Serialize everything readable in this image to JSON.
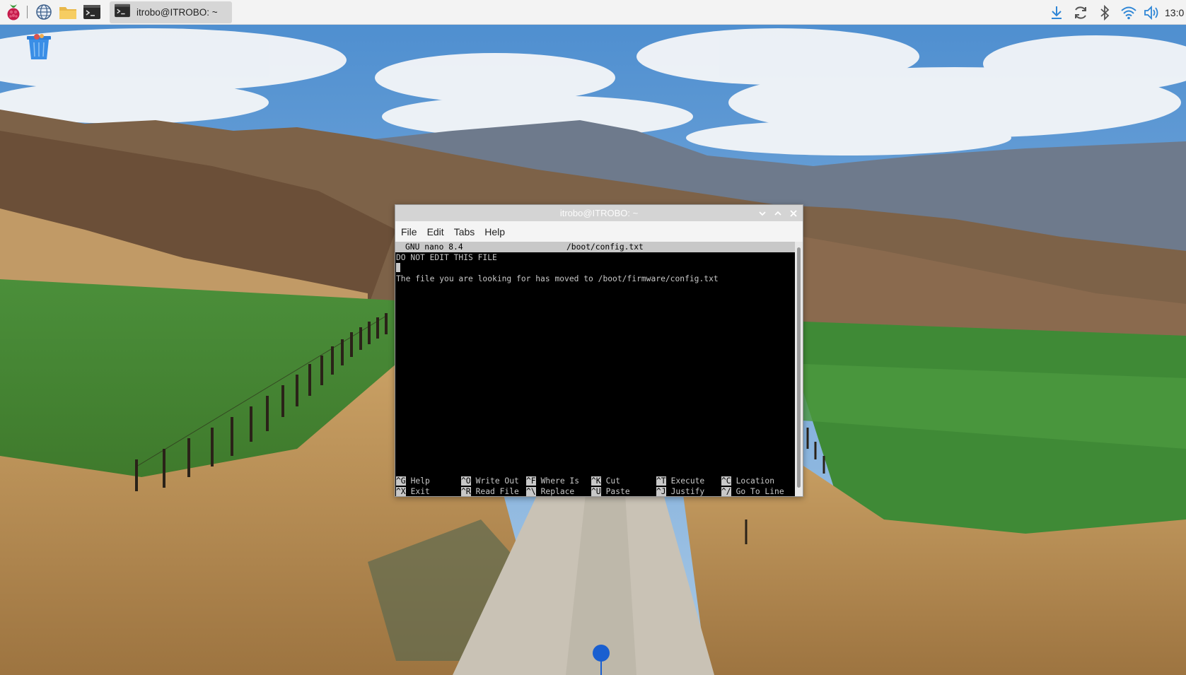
{
  "taskbar": {
    "launchers": [
      {
        "name": "raspberry-menu-icon"
      },
      {
        "name": "web-browser-icon"
      },
      {
        "name": "file-manager-icon"
      },
      {
        "name": "terminal-icon"
      }
    ],
    "task": {
      "label": "itrobo@ITROBO: ~"
    },
    "tray": [
      "download-icon",
      "sync-icon",
      "bluetooth-icon",
      "wifi-icon",
      "volume-icon"
    ],
    "clock": "13:0"
  },
  "desktop": {
    "icons": [
      {
        "name": "trash-icon"
      }
    ]
  },
  "window": {
    "title": "itrobo@ITROBO: ~",
    "menu": [
      "File",
      "Edit",
      "Tabs",
      "Help"
    ],
    "nano": {
      "version": "GNU nano 8.4",
      "filename": "/boot/config.txt",
      "lines": [
        "DO NOT EDIT THIS FILE",
        "",
        "The file you are looking for has moved to /boot/firmware/config.txt"
      ],
      "shortcuts": [
        [
          {
            "key": "^G",
            "label": "Help"
          },
          {
            "key": "^O",
            "label": "Write Out"
          },
          {
            "key": "^F",
            "label": "Where Is"
          },
          {
            "key": "^K",
            "label": "Cut"
          },
          {
            "key": "^T",
            "label": "Execute"
          },
          {
            "key": "^C",
            "label": "Location"
          }
        ],
        [
          {
            "key": "^X",
            "label": "Exit"
          },
          {
            "key": "^R",
            "label": "Read File"
          },
          {
            "key": "^\\",
            "label": "Replace"
          },
          {
            "key": "^U",
            "label": "Paste"
          },
          {
            "key": "^J",
            "label": "Justify"
          },
          {
            "key": "^/",
            "label": "Go To Line"
          }
        ]
      ]
    }
  },
  "colors": {
    "taskbar_bg": "#f3f3f3",
    "terminal_bg": "#000000",
    "terminal_fg": "#c8c8c8",
    "accent": "#1a7fd0"
  }
}
